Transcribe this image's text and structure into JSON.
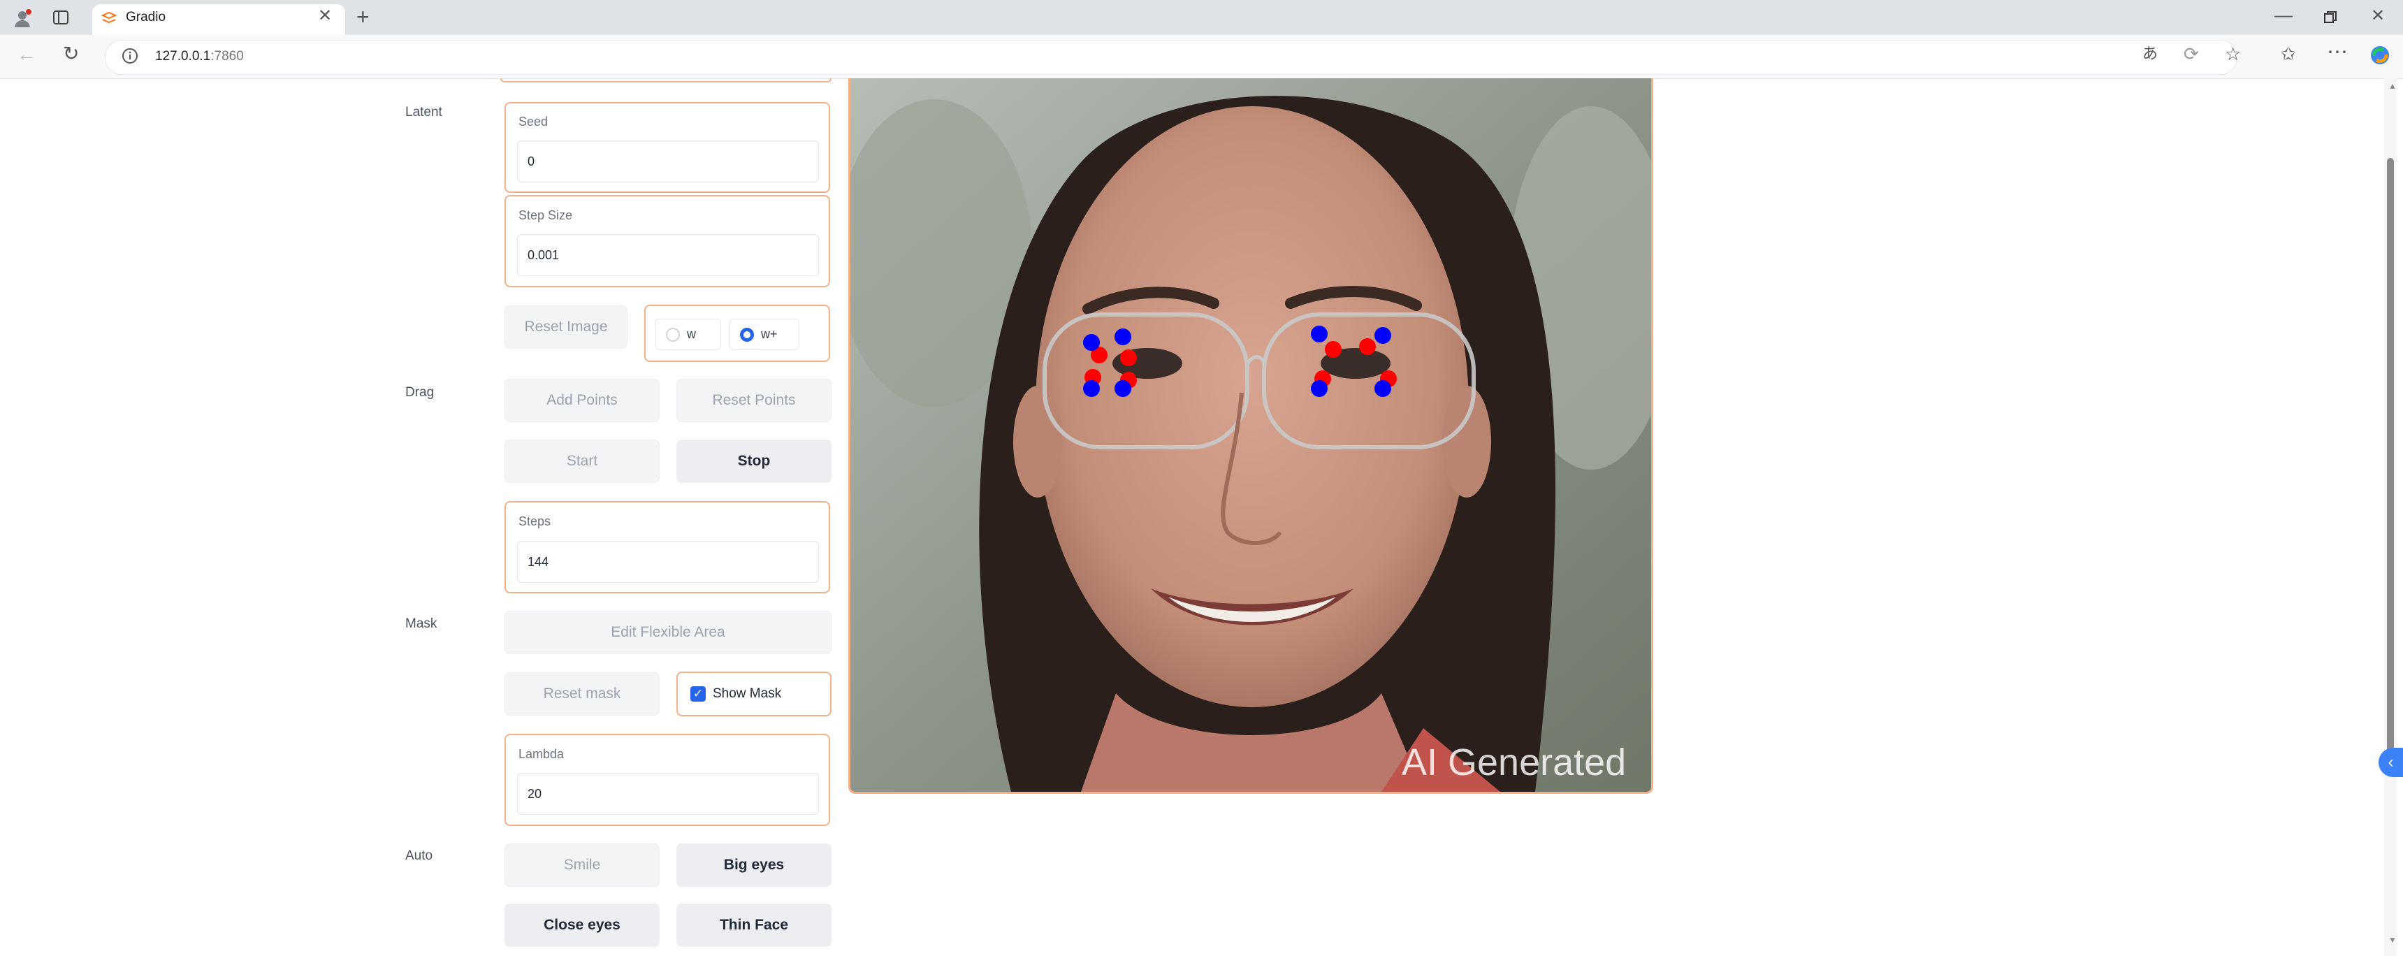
{
  "browser": {
    "tab_title": "Gradio",
    "url_host": "127.0.0.1",
    "url_port": ":7860"
  },
  "latent": {
    "row_label": "Latent",
    "seed_label": "Seed",
    "seed_value": "0",
    "step_size_label": "Step Size",
    "step_size_value": "0.001",
    "reset_image": "Reset Image",
    "radio_w": "w",
    "radio_wplus": "w+",
    "radio_selected": "w+"
  },
  "drag": {
    "row_label": "Drag",
    "add_points": "Add Points",
    "reset_points": "Reset Points",
    "start": "Start",
    "stop": "Stop",
    "steps_label": "Steps",
    "steps_value": "144"
  },
  "mask": {
    "row_label": "Mask",
    "edit_flexible_area": "Edit Flexible Area",
    "reset_mask": "Reset mask",
    "show_mask": "Show Mask",
    "show_mask_checked": true,
    "lambda_label": "Lambda",
    "lambda_value": "20"
  },
  "auto": {
    "row_label": "Auto",
    "smile": "Smile",
    "big_eyes": "Big eyes",
    "close_eyes": "Close eyes",
    "thin_face": "Thin Face"
  },
  "image": {
    "watermark": "AI Generated"
  },
  "colors": {
    "accent_border": "#f4b188",
    "handle_point": "#ff0000",
    "target_point": "#0000ff",
    "radio_checked": "#2563eb"
  }
}
